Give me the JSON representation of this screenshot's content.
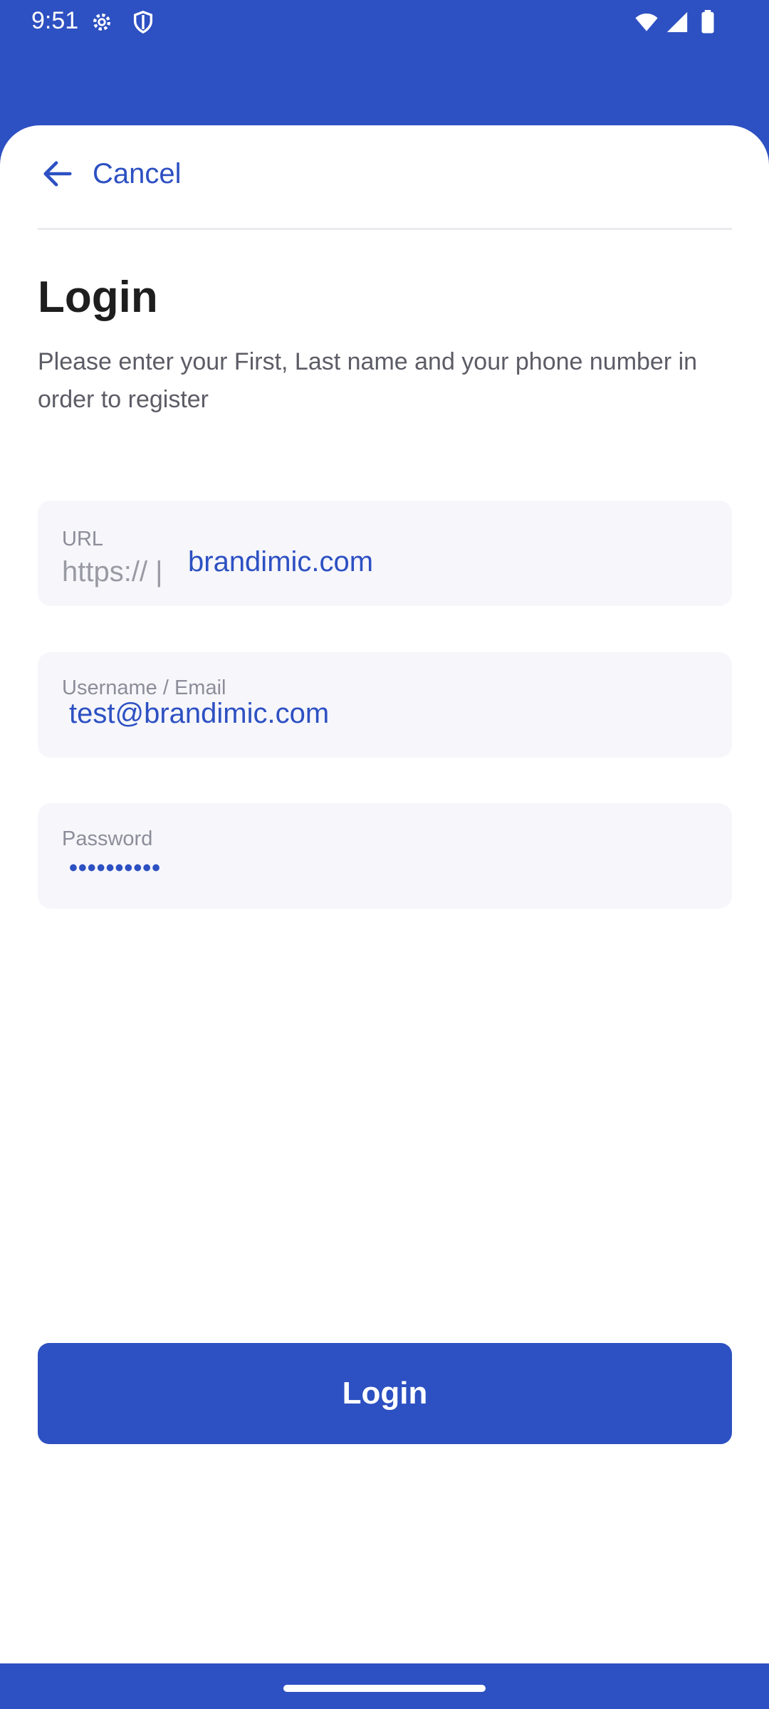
{
  "status_bar": {
    "time": "9:51",
    "icons_left": [
      "settings-icon",
      "shield-icon"
    ],
    "icons_right": [
      "wifi-icon",
      "signal-icon",
      "battery-icon"
    ]
  },
  "topbar": {
    "back_icon": "arrow-left-icon",
    "cancel_label": "Cancel"
  },
  "page": {
    "title": "Login",
    "subtitle": "Please enter your First, Last name and your phone number in order to register"
  },
  "form": {
    "url": {
      "label": "URL",
      "prefix": "https:// |",
      "value": "brandimic.com"
    },
    "username": {
      "label": "Username / Email",
      "value": "test@brandimic.com"
    },
    "password": {
      "label": "Password",
      "value": "••••••••••"
    }
  },
  "login_button": {
    "label": "Login"
  },
  "colors": {
    "primary": "#2d50c2",
    "field_bg": "#f6f6fb",
    "text": "#1e1e1e"
  }
}
